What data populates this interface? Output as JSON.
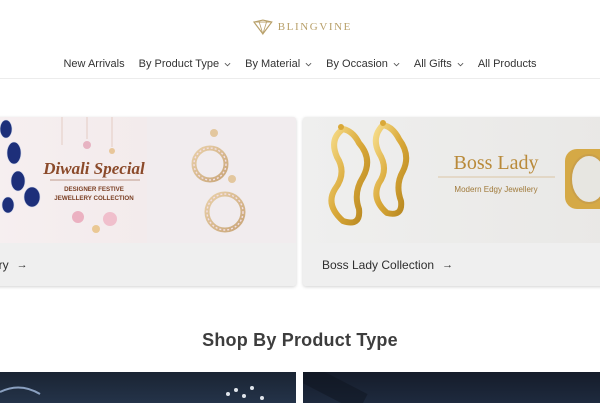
{
  "brand": {
    "name": "BLINGVINE",
    "accent": "#b8a06a"
  },
  "nav": {
    "items": [
      {
        "label": "New Arrivals",
        "has_dropdown": false
      },
      {
        "label": "By Product Type",
        "has_dropdown": true
      },
      {
        "label": "By Material",
        "has_dropdown": true
      },
      {
        "label": "By Occasion",
        "has_dropdown": true
      },
      {
        "label": "All Gifts",
        "has_dropdown": true
      },
      {
        "label": "All Products",
        "has_dropdown": false
      }
    ]
  },
  "collections": [
    {
      "caption": "ery",
      "banner_title": "Diwali Special",
      "banner_line1": "DESIGNER FESTIVE",
      "banner_line2": "JEWELLERY COLLECTION"
    },
    {
      "caption": "Boss Lady Collection",
      "banner_title": "Boss Lady",
      "banner_subtitle": "Modern Edgy Jewellery"
    }
  ],
  "section": {
    "title": "Shop By Product Type"
  },
  "icons": {
    "arrow": "arrow-right-icon",
    "chevron": "chevron-down-icon"
  }
}
